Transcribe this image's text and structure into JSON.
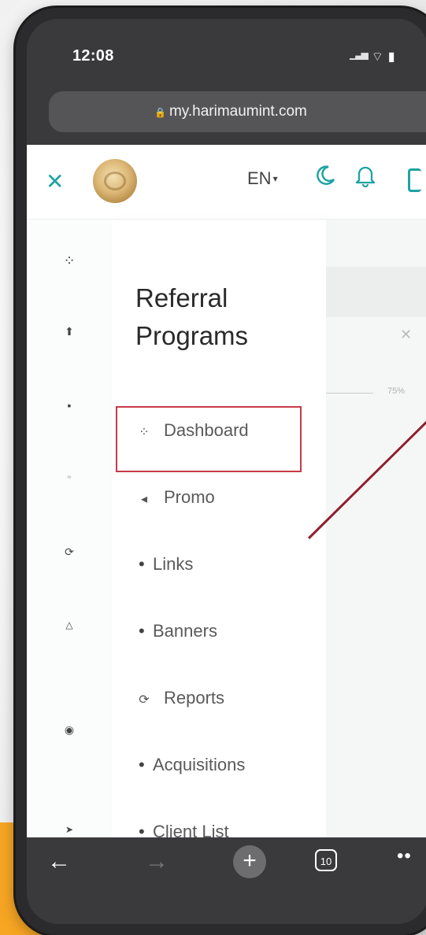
{
  "status": {
    "time": "12:08",
    "signal_icon": "signal-bars-icon",
    "wifi_icon": "wifi-icon",
    "battery_icon": "battery-icon"
  },
  "browser": {
    "url": "my.harimaumint.com",
    "share_icon": "share-icon",
    "tab_count": "10"
  },
  "header": {
    "close_icon": "close-icon",
    "language": "EN",
    "accent_color": "#1fa3a3"
  },
  "panel": {
    "title": "Referral Programs",
    "menu": [
      {
        "label": "Dashboard",
        "icon": "dashboard-grid-icon"
      },
      {
        "label": "Promo",
        "icon": "megaphone-icon"
      },
      {
        "label": "Links",
        "type": "sub"
      },
      {
        "label": "Banners",
        "type": "sub"
      },
      {
        "label": "Reports",
        "icon": "refresh-icon"
      },
      {
        "label": "Acquisitions",
        "type": "sub"
      },
      {
        "label": "Client List",
        "type": "sub"
      }
    ]
  },
  "background": {
    "percent": "75%"
  },
  "annotation": {
    "color": "#c83a48"
  }
}
